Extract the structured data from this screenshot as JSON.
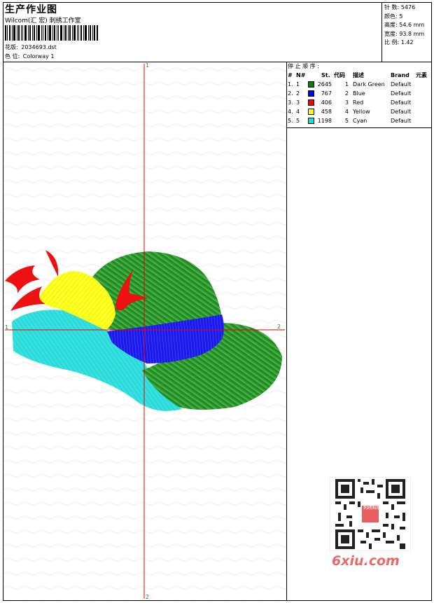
{
  "header": {
    "title": "生产作业图",
    "company": "Wilcom(汇 宏) 刺绣工作室",
    "design_label": "花版:",
    "design_value": "2034693.dst",
    "colorway_label": "色 位:",
    "colorway_value": "Colorway 1"
  },
  "stats": [
    {
      "label": "针 数:",
      "value": "5476"
    },
    {
      "label": "颜色:",
      "value": "5"
    },
    {
      "label": "高度:",
      "value": "54.6 mm"
    },
    {
      "label": "宽度:",
      "value": "93.8 mm"
    },
    {
      "label": "比 例:",
      "value": "1.42"
    }
  ],
  "stop_sequence": {
    "title": "停 止 顺 序 :",
    "headers": {
      "num": "#",
      "n": "N#",
      "st": "St.",
      "code": "代码",
      "desc": "描述",
      "brand": "Brand",
      "elem": "元素"
    },
    "rows": [
      {
        "num": "1.",
        "n": "1",
        "color": "#008000",
        "st": "2645",
        "code": "1",
        "desc": "Dark Green",
        "brand": "Default"
      },
      {
        "num": "2.",
        "n": "2",
        "color": "#0000ff",
        "st": "767",
        "code": "2",
        "desc": "Blue",
        "brand": "Default"
      },
      {
        "num": "3.",
        "n": "3",
        "color": "#ff0000",
        "st": "406",
        "code": "3",
        "desc": "Red",
        "brand": "Default"
      },
      {
        "num": "4.",
        "n": "4",
        "color": "#ffff00",
        "st": "458",
        "code": "4",
        "desc": "Yellow",
        "brand": "Default"
      },
      {
        "num": "5.",
        "n": "5",
        "color": "#00e5e5",
        "st": "1198",
        "code": "5",
        "desc": "Cyan",
        "brand": "Default"
      }
    ]
  },
  "axes": {
    "top": "1",
    "bottom": "2",
    "left": "1",
    "right": "2"
  },
  "watermark": {
    "text": "6xiu.com",
    "stamp": "刺绣图库"
  }
}
